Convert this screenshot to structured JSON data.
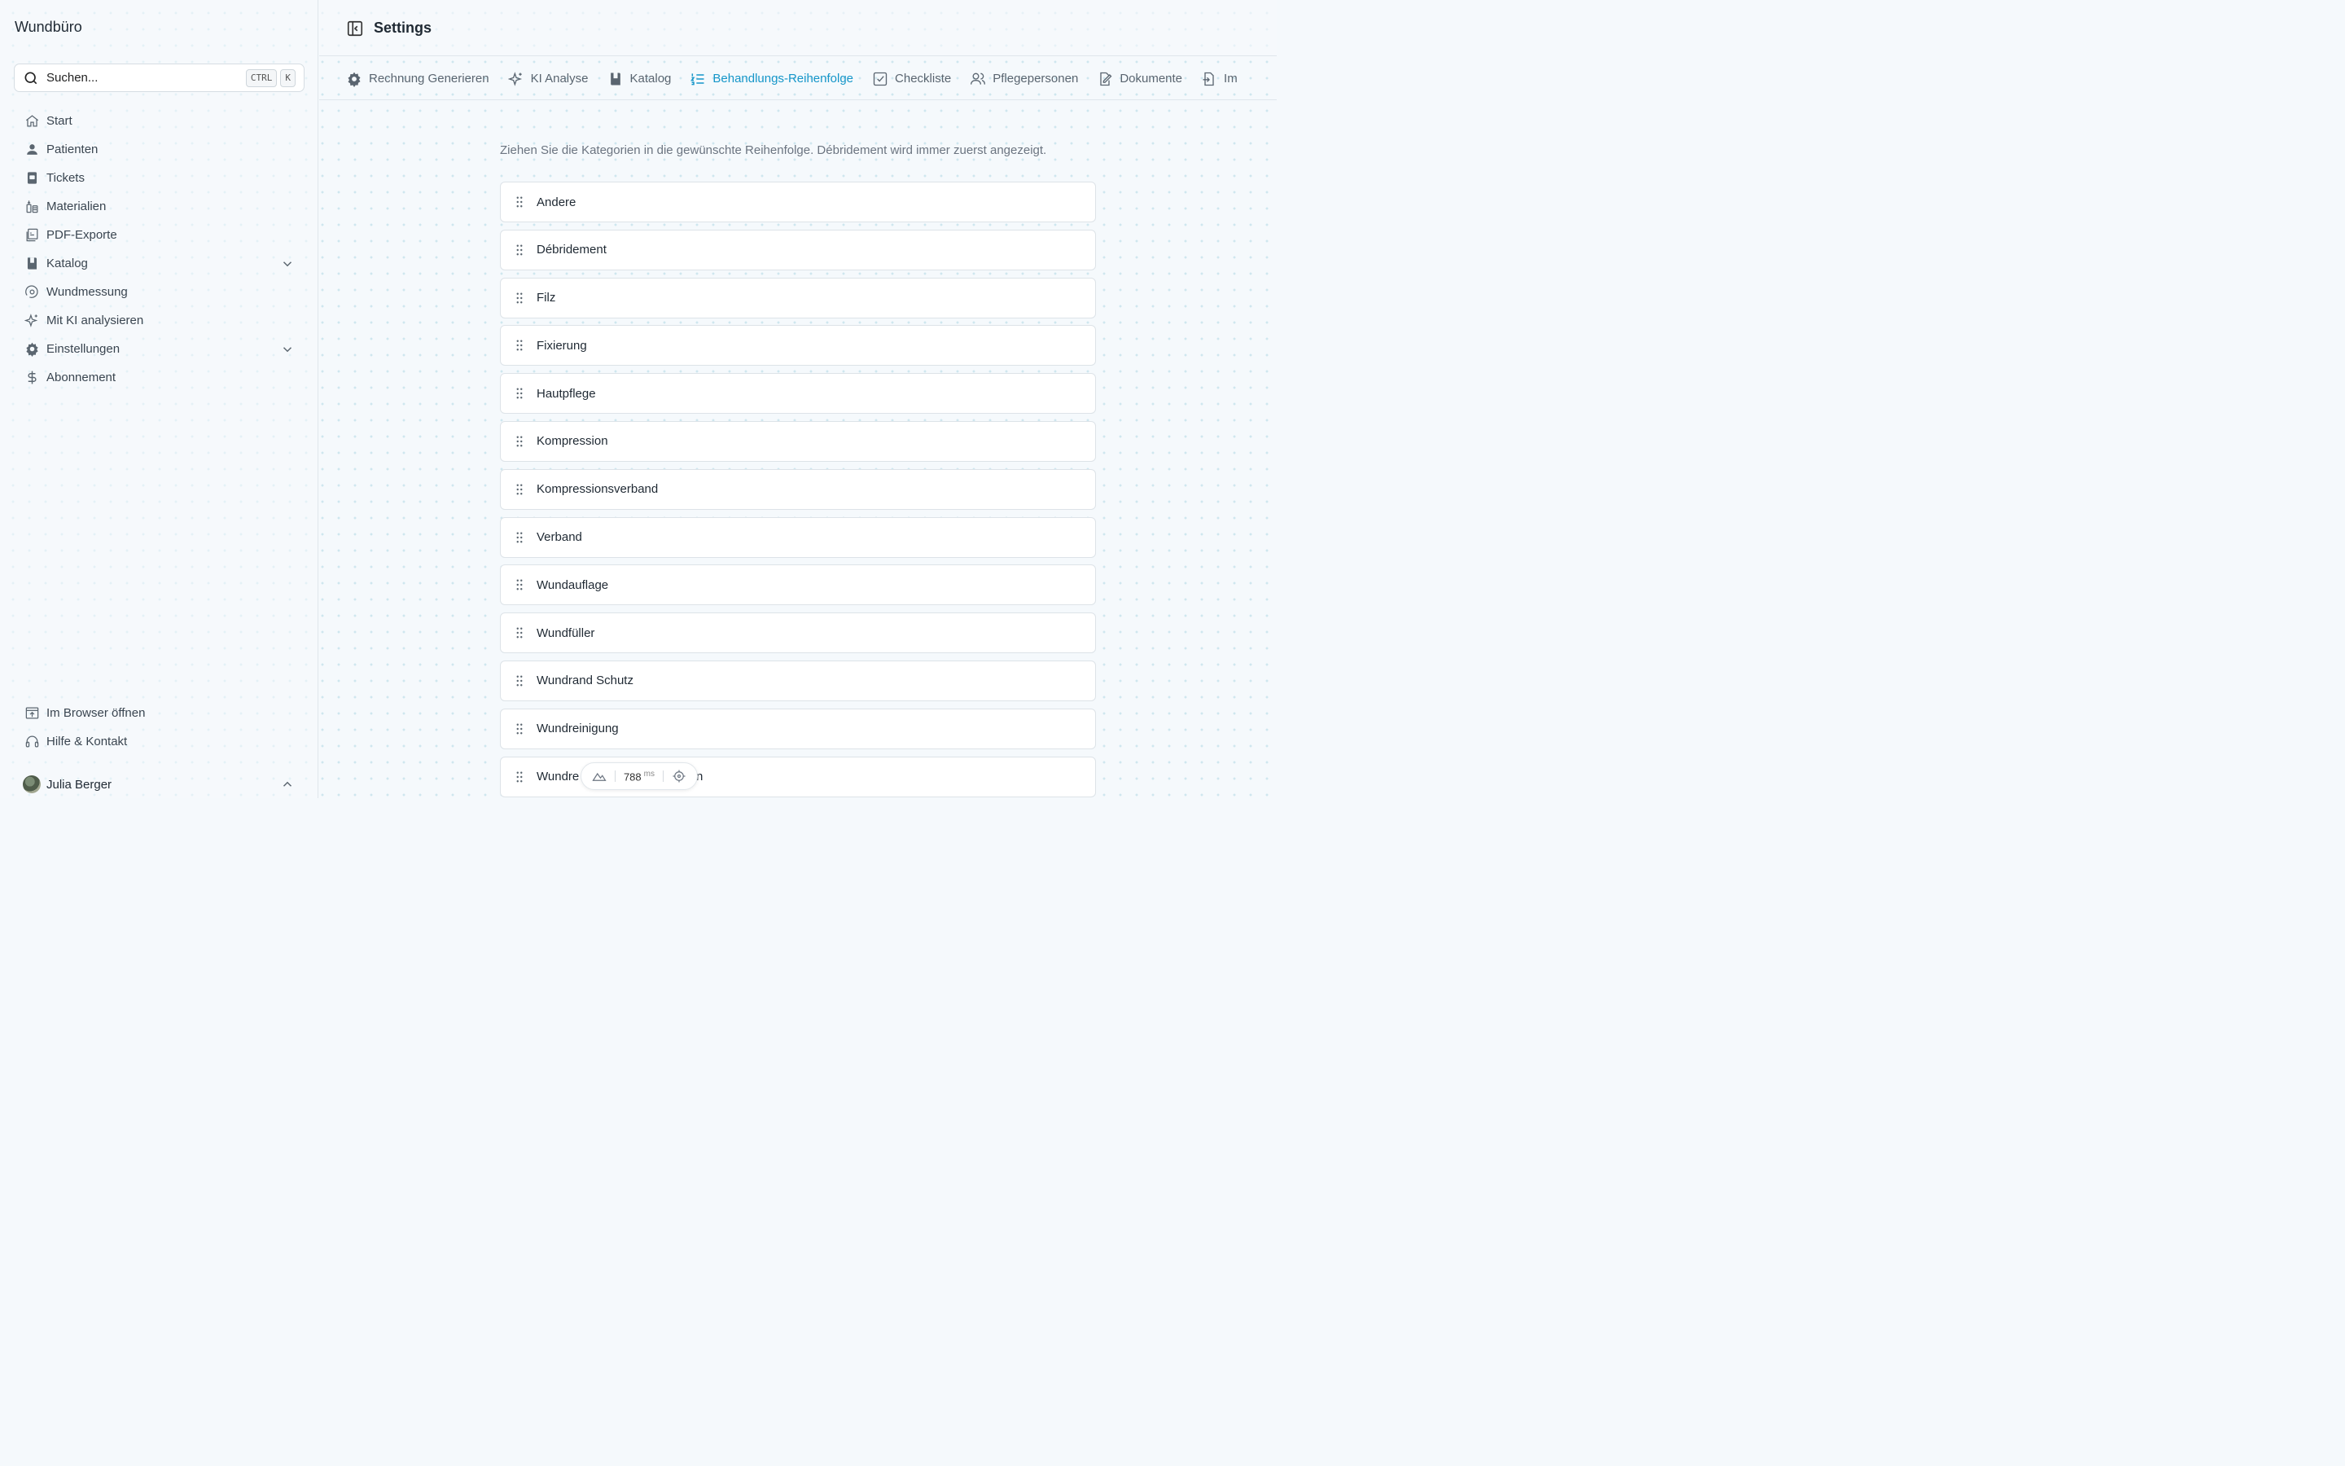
{
  "app": {
    "brand": "Wundbüro"
  },
  "search": {
    "placeholder": "Suchen...",
    "kbd_ctrl": "CTRL",
    "kbd_k": "K"
  },
  "sidebar": {
    "items": [
      {
        "label": "Start",
        "icon": "home-icon"
      },
      {
        "label": "Patienten",
        "icon": "user-icon"
      },
      {
        "label": "Tickets",
        "icon": "ticket-icon"
      },
      {
        "label": "Materialien",
        "icon": "materials-icon"
      },
      {
        "label": "PDF-Exporte",
        "icon": "pdf-icon"
      },
      {
        "label": "Katalog",
        "icon": "book-icon",
        "expandable": true
      },
      {
        "label": "Wundmessung",
        "icon": "measure-icon"
      },
      {
        "label": "Mit KI analysieren",
        "icon": "sparkles-icon"
      },
      {
        "label": "Einstellungen",
        "icon": "gear-icon",
        "expandable": true
      },
      {
        "label": "Abonnement",
        "icon": "dollar-icon"
      }
    ],
    "bottom": [
      {
        "label": "Im Browser öffnen",
        "icon": "browser-icon"
      },
      {
        "label": "Hilfe & Kontakt",
        "icon": "headset-icon"
      }
    ],
    "user": {
      "name": "Julia Berger"
    }
  },
  "header": {
    "title": "Settings"
  },
  "tabs": [
    {
      "label": "Rechnung Generieren",
      "icon": "gear-icon"
    },
    {
      "label": "KI Analyse",
      "icon": "sparkles-icon"
    },
    {
      "label": "Katalog",
      "icon": "book-icon"
    },
    {
      "label": "Behandlungs-Reihenfolge",
      "icon": "list-ordered-icon",
      "active": true
    },
    {
      "label": "Checkliste",
      "icon": "checkbox-icon"
    },
    {
      "label": "Pflegepersonen",
      "icon": "users-icon"
    },
    {
      "label": "Dokumente",
      "icon": "document-edit-icon"
    },
    {
      "label": "Im",
      "icon": "import-icon"
    }
  ],
  "main": {
    "hint": "Ziehen Sie die Kategorien in die gewünschte Reihenfolge. Débridement wird immer zuerst angezeigt.",
    "categories": [
      "Andere",
      "Débridement",
      "Filz",
      "Fixierung",
      "Hautpflege",
      "Kompression",
      "Kompressionsverband",
      "Verband",
      "Wundauflage",
      "Wundfüller",
      "Wundrand Schutz",
      "Wundreinigung",
      "Wundre"
    ],
    "partial_suffix": "n"
  },
  "perf": {
    "value": "788",
    "unit": "ms"
  },
  "colors": {
    "accent": "#1596c9",
    "text": "#1f2933",
    "muted": "#6b7480"
  }
}
